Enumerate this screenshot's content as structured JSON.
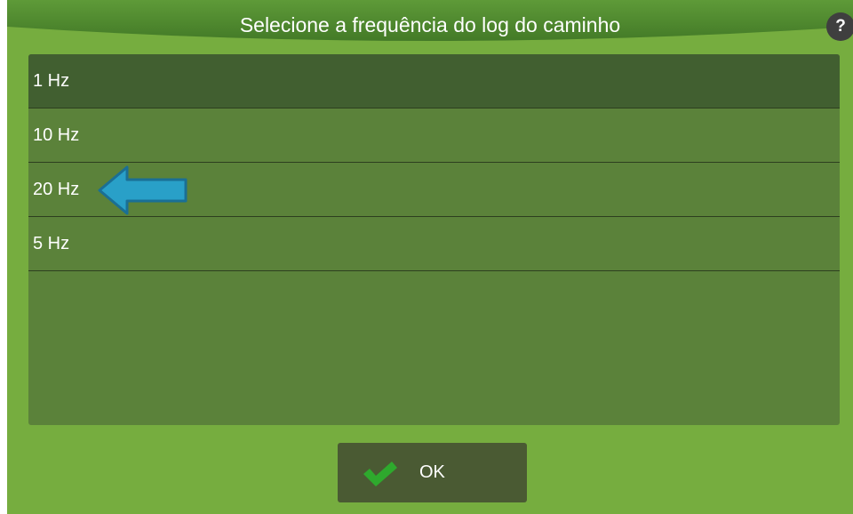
{
  "dialog": {
    "title": "Selecione a frequência do log do caminho",
    "help_label": "?"
  },
  "list": {
    "items": [
      {
        "label": "1 Hz",
        "selected": true
      },
      {
        "label": "10 Hz",
        "selected": false
      },
      {
        "label": "20 Hz",
        "selected": false
      },
      {
        "label": "5 Hz",
        "selected": false
      }
    ]
  },
  "footer": {
    "ok_label": "OK"
  },
  "icons": {
    "help": "question-mark-icon",
    "confirm": "checkmark-icon",
    "pointer": "left-arrow-icon"
  },
  "colors": {
    "background": "#76ad3f",
    "header": "#4e8a2e",
    "list_panel": "#5b823a",
    "selected_row": "#415f30",
    "ok_button": "#4a5a33",
    "checkmark": "#2ea92d",
    "pointer_arrow": "#29a0c8"
  }
}
